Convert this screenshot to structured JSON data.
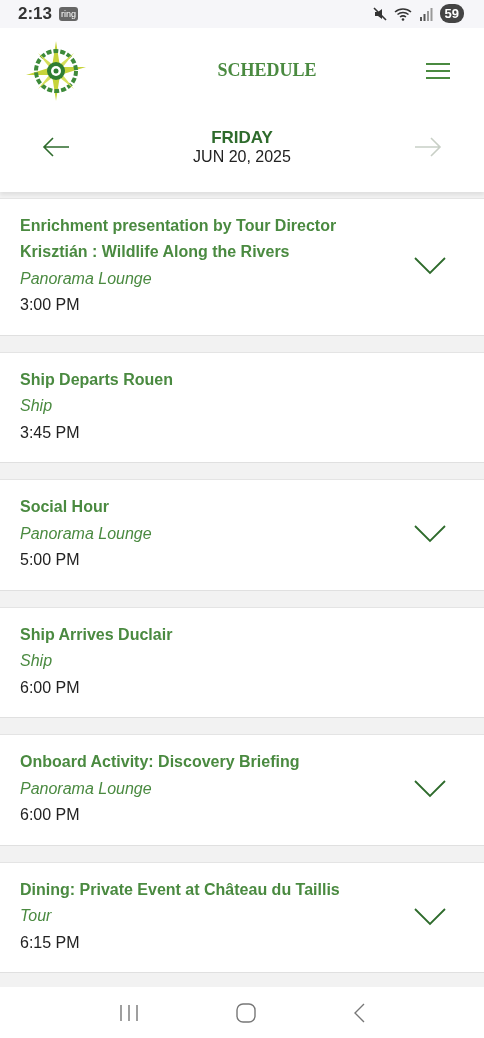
{
  "status_bar": {
    "time": "2:13",
    "app_badge": "ring",
    "battery": "59"
  },
  "header": {
    "title": "SCHEDULE"
  },
  "date_nav": {
    "day": "FRIDAY",
    "date": "JUN 20, 2025",
    "prev_disabled": false,
    "next_disabled": true
  },
  "events": [
    {
      "title": "Enrichment presentation by Tour Director Krisztián : Wildlife Along the Rivers",
      "location": "Panorama Lounge",
      "time": "3:00 PM",
      "expandable": true
    },
    {
      "title": "Ship Departs Rouen",
      "location": "Ship",
      "time": "3:45 PM",
      "expandable": false
    },
    {
      "title": "Social Hour",
      "location": "Panorama Lounge",
      "time": "5:00 PM",
      "expandable": true
    },
    {
      "title": "Ship Arrives Duclair",
      "location": "Ship",
      "time": "6:00 PM",
      "expandable": false
    },
    {
      "title": "Onboard Activity: Discovery Briefing",
      "location": "Panorama Lounge",
      "time": "6:00 PM",
      "expandable": true
    },
    {
      "title": "Dining: Private Event at Château du Taillis",
      "location": "Tour",
      "time": "6:15 PM",
      "expandable": true
    }
  ]
}
